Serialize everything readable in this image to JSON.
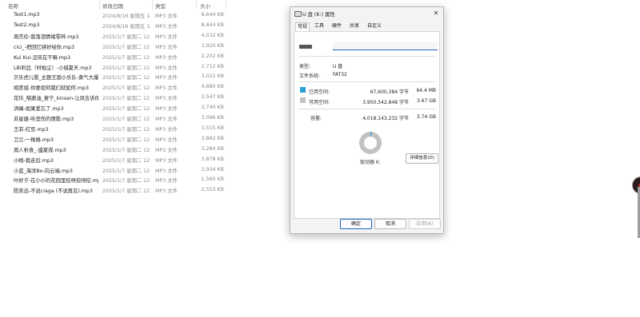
{
  "file_list": {
    "columns": [
      "名称",
      "修改日期",
      "类型",
      "大小"
    ],
    "rows": [
      {
        "name": "Test1.mp3",
        "date": "2024/8/16 星期五 18...",
        "type": "MP3 文件",
        "size": "8,644 KB"
      },
      {
        "name": "Test2.mp3",
        "date": "2024/8/16 星期五 18...",
        "type": "MP3 文件",
        "size": "8,644 KB"
      },
      {
        "name": "周杰伦-我落泪情绪零碎.mp3",
        "date": "2025/1/7 星期二 12:31",
        "type": "MP3 文件",
        "size": "4,032 KB"
      },
      {
        "name": "cici_-把回忆拼好给你.mp3",
        "date": "2025/1/7 星期二 12:31",
        "type": "MP3 文件",
        "size": "3,920 KB"
      },
      {
        "name": "Kui Kui-涩风在干嘛.mp3",
        "date": "2025/1/7 星期二 12:31",
        "type": "MP3 文件",
        "size": "2,202 KB"
      },
      {
        "name": "LBI利比（时柏尘）-小城夏天.mp3",
        "date": "2025/1/7 星期二 12:30",
        "type": "MP3 文件",
        "size": "2,712 KB"
      },
      {
        "name": "贝乐虎儿歌_主题王国小乐队-勇气大爆发...",
        "date": "2025/1/7 星期二 12:31",
        "type": "MP3 文件",
        "size": "3,022 KB"
      },
      {
        "name": "胡彦斌-你要如何我们就如何.mp3",
        "date": "2025/1/7 星期二 12:31",
        "type": "MP3 文件",
        "size": "4,680 KB"
      },
      {
        "name": "花玲_喵酱油_宴宁_kinsen-让风告诉你.m...",
        "date": "2025/1/7 星期二 12:31",
        "type": "MP3 文件",
        "size": "3,547 KB"
      },
      {
        "name": "洪峰-如果爱忘了.mp3",
        "date": "2025/1/7 星期二 12:31",
        "type": "MP3 文件",
        "size": "3,740 KB"
      },
      {
        "name": "苏星捷-听悲伤的情歌.mp3",
        "date": "2025/1/7 星期二 12:31",
        "type": "MP3 文件",
        "size": "3,096 KB"
      },
      {
        "name": "王菲-红豆.mp3",
        "date": "2025/1/7 星期二 12:31",
        "type": "MP3 文件",
        "size": "3,515 KB"
      },
      {
        "name": "卫兰-一格格.mp3",
        "date": "2025/1/7 星期二 12:31",
        "type": "MP3 文件",
        "size": "3,882 KB"
      },
      {
        "name": "周人析食_-盛夏夜.mp3",
        "date": "2025/1/7 星期二 12:30",
        "type": "MP3 文件",
        "size": "3,284 KB"
      },
      {
        "name": "小贱-我走后.mp3",
        "date": "2025/1/7 星期二 12:31",
        "type": "MP3 文件",
        "size": "3,878 KB"
      },
      {
        "name": "小蓝_海洋Bo-向云端.mp3",
        "date": "2025/1/7 星期二 12:30",
        "type": "MP3 文件",
        "size": "3,934 KB"
      },
      {
        "name": "叶好夕-在小小的花园里挖呀挖呀挖.mp3",
        "date": "2025/1/7 星期二 12:31",
        "type": "MP3 文件",
        "size": "1,560 KB"
      },
      {
        "name": "陈奕迅-不说ciaga (不说再见).mp3",
        "date": "2025/1/7 星期二 12:31",
        "type": "MP3 文件",
        "size": "2,553 KB"
      }
    ]
  },
  "dialog": {
    "title": "U 盘 (K:) 属性",
    "close": "✕",
    "tabs": [
      "常规",
      "工具",
      "硬件",
      "共享",
      "自定义"
    ],
    "active_tab": 0,
    "name_value": "",
    "type_label": "类型:",
    "type_value": "U 盘",
    "fs_label": "文件系统:",
    "fs_value": "FAT32",
    "used_label": "已用空间:",
    "used_bytes": "67,600,384 字节",
    "used_size": "64.4 MB",
    "free_label": "可用空间:",
    "free_bytes": "3,950,542,848 字节",
    "free_size": "3.67 GB",
    "capacity_label": "容量:",
    "capacity_bytes": "4,018,143,232 字节",
    "capacity_size": "3.74 GB",
    "drive_label": "驱动器 K:",
    "details_button": "详细信息(D)",
    "ok_button": "确定",
    "cancel_button": "取消",
    "apply_button": "应用(A)",
    "used_fraction": 0.017,
    "colors": {
      "used": "#2a9fd6",
      "free": "#c2c2c2",
      "accent": "#1f62c4"
    }
  }
}
